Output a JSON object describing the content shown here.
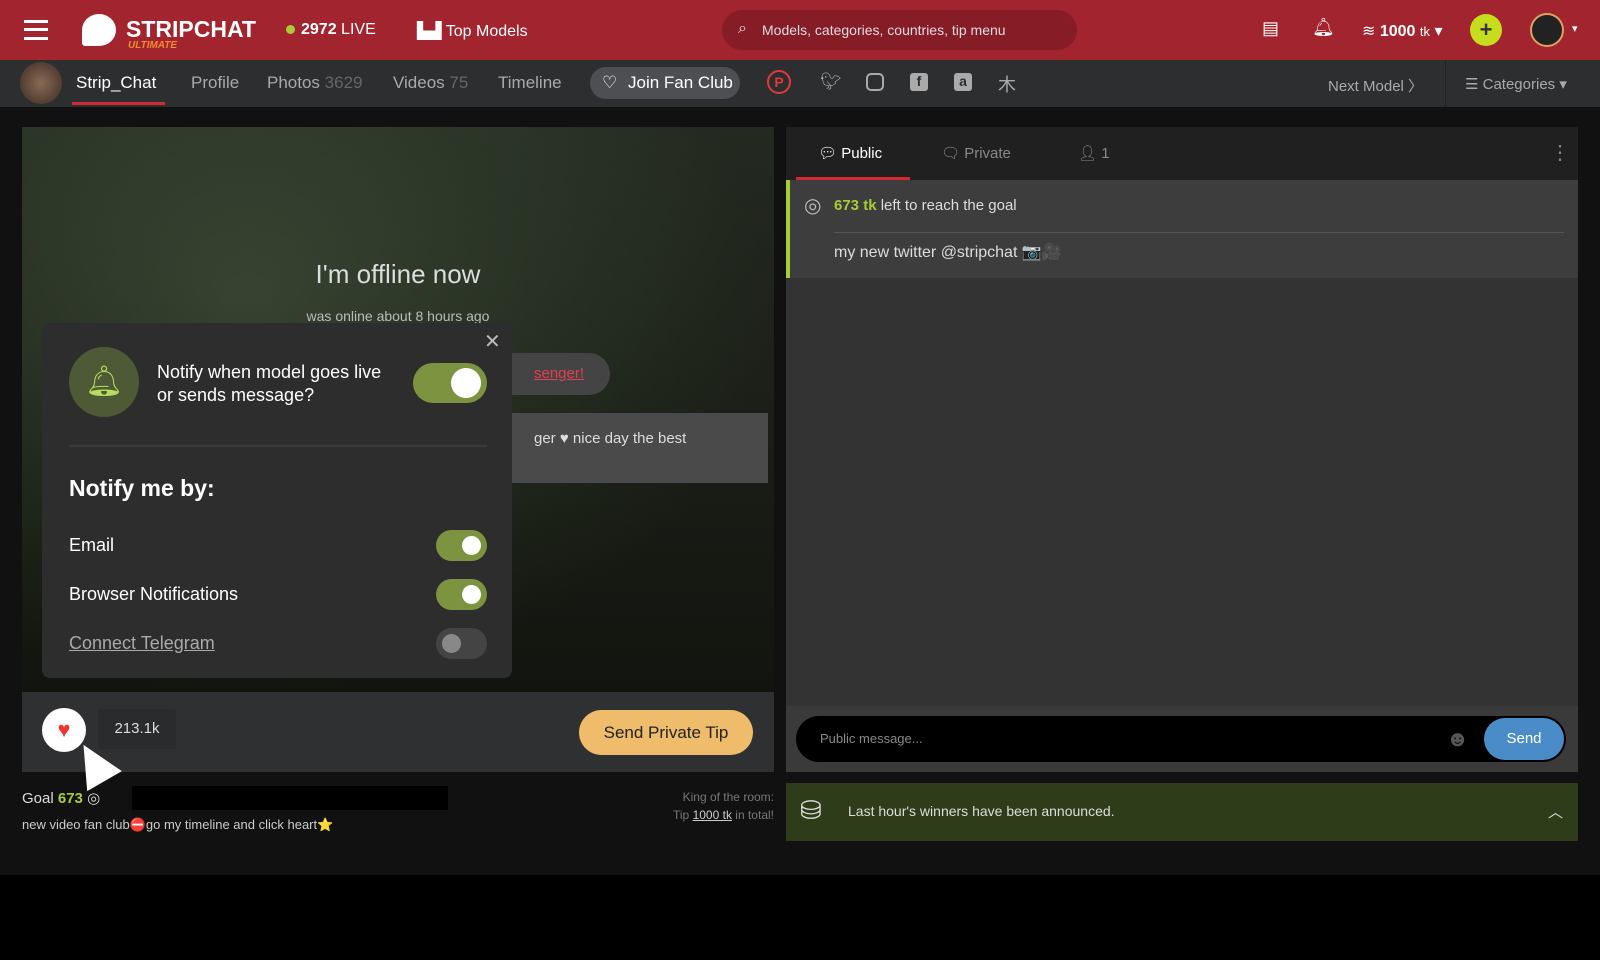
{
  "header": {
    "logo_text": "STRIPCHAT",
    "logo_sub": "ULTIMATE",
    "live_count": "2972",
    "live_label": "LIVE",
    "top_models": "Top Models",
    "search_placeholder": "Models, categories, countries, tip menu",
    "tokens": "1000",
    "token_unit": "tk",
    "accent": "#a2242f"
  },
  "subnav": {
    "username": "Strip_Chat",
    "profile": "Profile",
    "photos": "Photos",
    "photos_count": "3629",
    "videos": "Videos",
    "videos_count": "75",
    "timeline": "Timeline",
    "join_fan_club": "Join Fan Club",
    "next_model": "Next Model",
    "categories": "Categories"
  },
  "video": {
    "offline_title": "I'm offline now",
    "offline_sub": "was online about 8 hours ago",
    "messenger_link": "senger!",
    "bio_snippet": "ger ♥ nice day the best"
  },
  "popup": {
    "question": "Notify when model goes live or sends message?",
    "question_on": true,
    "notify_by": "Notify me by:",
    "options": [
      {
        "label": "Email",
        "on": true
      },
      {
        "label": "Browser Notifications",
        "on": true
      },
      {
        "label": "Connect Telegram",
        "on": false
      }
    ]
  },
  "bar": {
    "likes": "213.1k",
    "send_private_tip": "Send Private Tip"
  },
  "below": {
    "goal_label": "Goal",
    "goal_value": "673",
    "description": "new video fan club⛔go my timeline and click heart⭐",
    "king_label": "King of the room:",
    "king_tip_pre": "Tip",
    "king_tip_amount": "1000 tk",
    "king_tip_post": "in total!"
  },
  "chat": {
    "tabs": [
      {
        "label": "Public"
      },
      {
        "label": "Private"
      },
      {
        "label": "1"
      }
    ],
    "goal_amount": "673 tk",
    "goal_text": "left to reach the goal",
    "topic": "my new twitter @stripchat 📷🎥",
    "input_placeholder": "Public message...",
    "send": "Send",
    "winners": "Last hour's winners have been announced."
  }
}
